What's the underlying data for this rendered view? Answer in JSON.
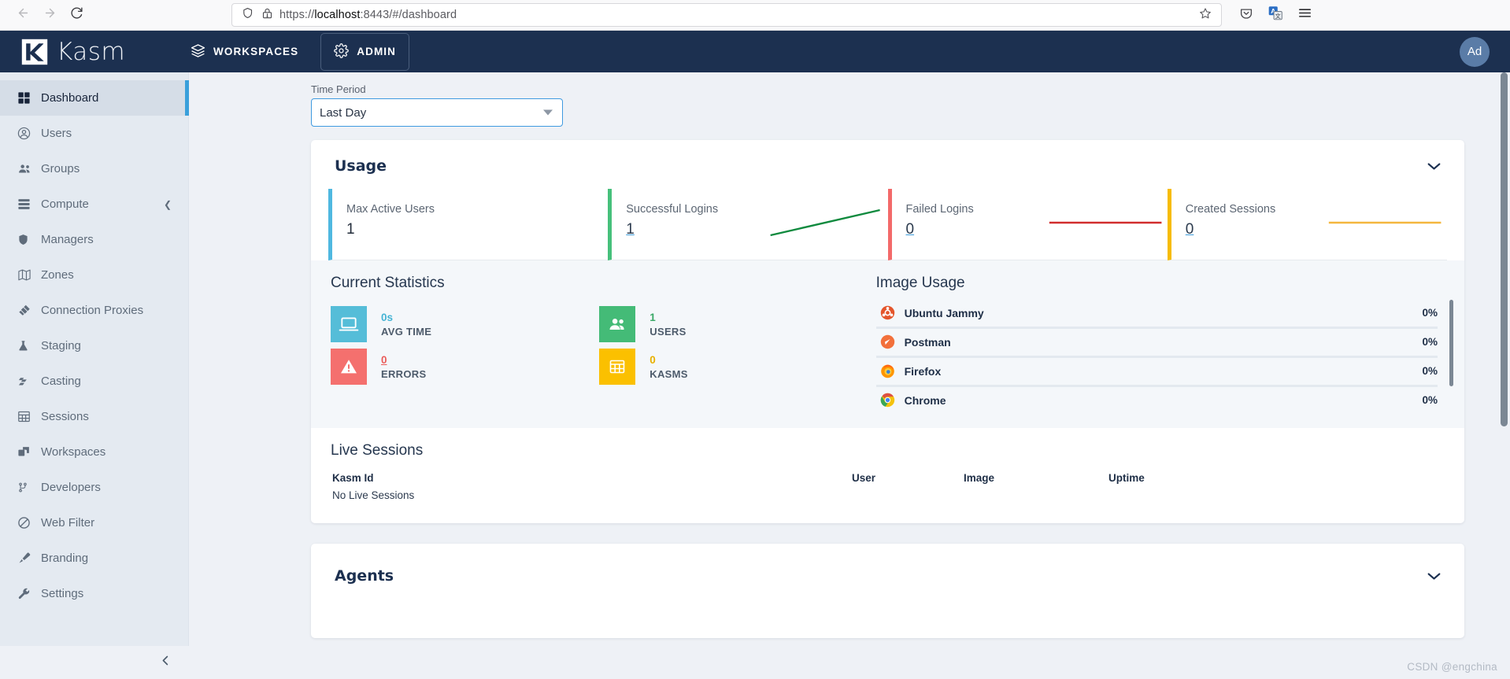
{
  "browser": {
    "back_icon": "back-arrow-icon",
    "forward_icon": "forward-arrow-icon",
    "reload_icon": "reload-icon",
    "shield_icon": "shield-icon",
    "lock_warning_icon": "lock-warning-icon",
    "url_scheme": "https://",
    "url_host": "localhost",
    "url_path": ":8443/#/dashboard",
    "url_full": "https://localhost:8443/#/dashboard",
    "bookmark_icon": "star-icon",
    "pocket_icon": "pocket-icon",
    "translate_icon": "translate-icon",
    "menu_icon": "hamburger-menu-icon"
  },
  "header": {
    "logo_text": "Kasm",
    "workspaces_label": "WORKSPACES",
    "admin_label": "ADMIN",
    "workspaces_icon": "layers-icon",
    "admin_icon": "gear-icon",
    "avatar_initials": "Ad",
    "bg_color": "#1c3050"
  },
  "sidebar": {
    "collapse_icon": "chevron-left-icon",
    "items": [
      {
        "label": "Dashboard",
        "icon": "grid-icon",
        "active": true
      },
      {
        "label": "Users",
        "icon": "user-circle-icon",
        "active": false
      },
      {
        "label": "Groups",
        "icon": "users-icon",
        "active": false
      },
      {
        "label": "Compute",
        "icon": "server-icon",
        "active": false,
        "caret": "chevron-left-icon"
      },
      {
        "label": "Managers",
        "icon": "shield-icon",
        "active": false
      },
      {
        "label": "Zones",
        "icon": "map-icon",
        "active": false
      },
      {
        "label": "Connection Proxies",
        "icon": "plug-icon",
        "active": false
      },
      {
        "label": "Staging",
        "icon": "flask-icon",
        "active": false
      },
      {
        "label": "Casting",
        "icon": "cast-icon",
        "active": false
      },
      {
        "label": "Sessions",
        "icon": "table-icon",
        "active": false
      },
      {
        "label": "Workspaces",
        "icon": "windows-icon",
        "active": false
      },
      {
        "label": "Developers",
        "icon": "code-branch-icon",
        "active": false
      },
      {
        "label": "Web Filter",
        "icon": "ban-icon",
        "active": false
      },
      {
        "label": "Branding",
        "icon": "paintbrush-icon",
        "active": false
      },
      {
        "label": "Settings",
        "icon": "wrench-icon",
        "active": false
      }
    ]
  },
  "time_period": {
    "label": "Time Period",
    "value": "Last Day",
    "caret_icon": "chevron-down-icon"
  },
  "usage_card": {
    "title": "Usage",
    "collapse_icon": "chevron-down-icon",
    "tiles": [
      {
        "label": "Max Active Users",
        "value": "1",
        "color": "#4fb8e0",
        "link": false,
        "spark": "none"
      },
      {
        "label": "Successful Logins",
        "value": "1",
        "color": "#46c07b",
        "link": true,
        "spark": "rising",
        "spark_color": "#0f8a3e"
      },
      {
        "label": "Failed Logins",
        "value": "0",
        "color": "#f36a6a",
        "link": true,
        "spark": "flat",
        "spark_color": "#d12d2d"
      },
      {
        "label": "Created Sessions",
        "value": "0",
        "color": "#f7bc00",
        "link": true,
        "spark": "flat",
        "spark_color": "#f4b73f"
      }
    ]
  },
  "current_statistics": {
    "title": "Current Statistics",
    "stats": [
      {
        "value": "0s",
        "caption": "AVG TIME",
        "color": "#55bdd8",
        "icon": "laptop-icon",
        "underline": false
      },
      {
        "value": "1",
        "caption": "USERS",
        "color": "#44bb77",
        "icon": "users-icon",
        "underline": false
      },
      {
        "value": "0",
        "caption": "ERRORS",
        "color": "#f4706e",
        "icon": "warning-triangle-icon",
        "underline": true
      },
      {
        "value": "0",
        "caption": "KASMS",
        "color": "#fbc000",
        "icon": "grid-table-icon",
        "underline": false
      }
    ]
  },
  "image_usage": {
    "title": "Image Usage",
    "rows": [
      {
        "name": "Ubuntu Jammy",
        "percent": "0%",
        "icon": "ubuntu-icon"
      },
      {
        "name": "Postman",
        "percent": "0%",
        "icon": "postman-icon"
      },
      {
        "name": "Firefox",
        "percent": "0%",
        "icon": "firefox-icon"
      },
      {
        "name": "Chrome",
        "percent": "0%",
        "icon": "chrome-icon"
      }
    ]
  },
  "live_sessions": {
    "title": "Live Sessions",
    "columns": [
      "Kasm Id",
      "User",
      "Image",
      "Uptime"
    ],
    "empty_message": "No Live Sessions"
  },
  "agents_card": {
    "title": "Agents",
    "collapse_icon": "chevron-down-icon"
  },
  "watermark": "CSDN @engchina"
}
